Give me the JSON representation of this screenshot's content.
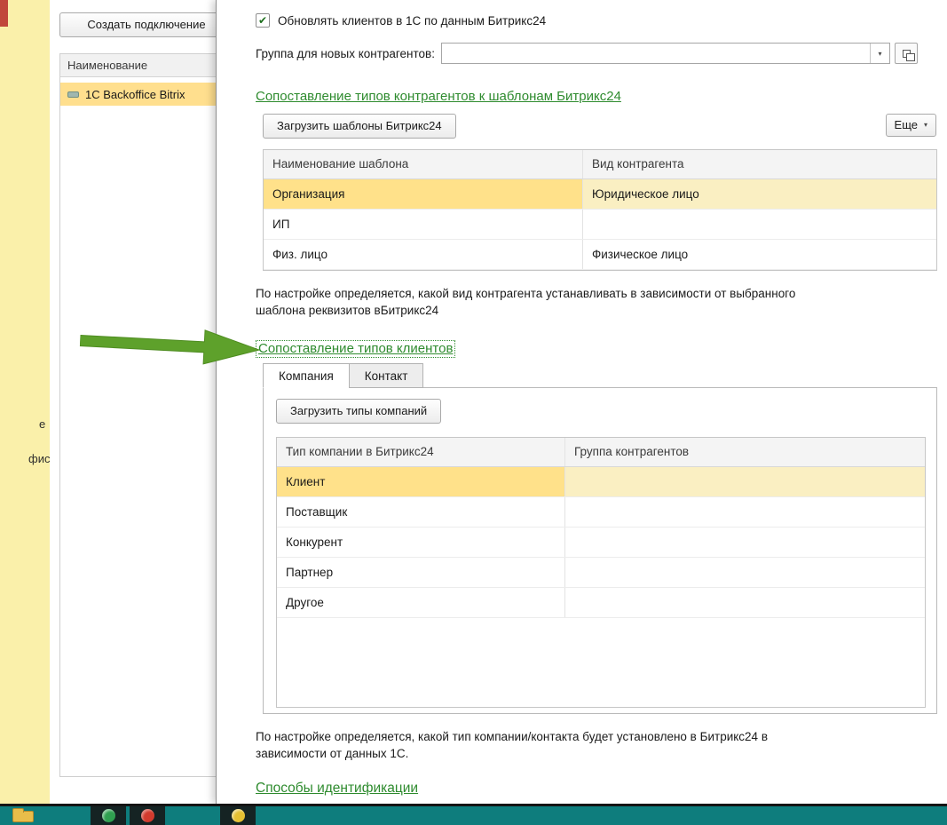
{
  "colors": {
    "accent_green": "#2e8b2e",
    "selection_yellow": "#ffe18a",
    "sidebar_yellow": "#faf0aa",
    "taskbar_teal": "#0e7d7d",
    "marker_red": "#c1473b",
    "arrow_green": "#5EA12B"
  },
  "icons": {
    "check": "✔",
    "dropdown": "▾",
    "more_arrow": "▾"
  },
  "sidebar": {
    "fragments": [
      "е",
      "фис"
    ]
  },
  "connections": {
    "create_button": "Создать подключение",
    "header": "Наименование",
    "rows": [
      {
        "name": "1C Backoffice Bitrix"
      }
    ]
  },
  "dialog": {
    "update_clients": {
      "checked": true,
      "label": "Обновлять клиентов в 1С по данным Битрикс24"
    },
    "new_group": {
      "label": "Группа для новых контрагентов:",
      "value": ""
    },
    "templates_section": {
      "title": "Сопоставление типов контрагентов к шаблонам Битрикс24",
      "load_button": "Загрузить шаблоны Битрикс24",
      "more_button": "Еще",
      "table": {
        "headers": [
          "Наименование шаблона",
          "Вид контрагента"
        ],
        "rows": [
          {
            "template": "Организация",
            "kind": "Юридическое лицо",
            "selected": true
          },
          {
            "template": "ИП",
            "kind": "",
            "selected": false
          },
          {
            "template": "Физ. лицо",
            "kind": "Физическое лицо",
            "selected": false
          }
        ]
      },
      "note": "По настройке определяется, какой вид контрагента устанавливать в зависимости от выбранного шаблона реквизитов вБитрикс24"
    },
    "client_types_section": {
      "title": "Сопоставление типов клиентов",
      "tabs": [
        {
          "label": "Компания",
          "active": true
        },
        {
          "label": "Контакт",
          "active": false
        }
      ],
      "load_button": "Загрузить типы компаний",
      "table": {
        "headers": [
          "Тип компании в Битрикс24",
          "Группа контрагентов"
        ],
        "rows": [
          {
            "type": "Клиент",
            "group": "",
            "selected": true
          },
          {
            "type": "Поставщик",
            "group": "",
            "selected": false
          },
          {
            "type": "Конкурент",
            "group": "",
            "selected": false
          },
          {
            "type": "Партнер",
            "group": "",
            "selected": false
          },
          {
            "type": "Другое",
            "group": "",
            "selected": false
          }
        ]
      },
      "note": "По настройке определяется, какой тип компании/контакта будет установлено в Битрикс24 в зависимости от данных 1С."
    },
    "identification_section": {
      "title": "Способы идентификации"
    }
  }
}
